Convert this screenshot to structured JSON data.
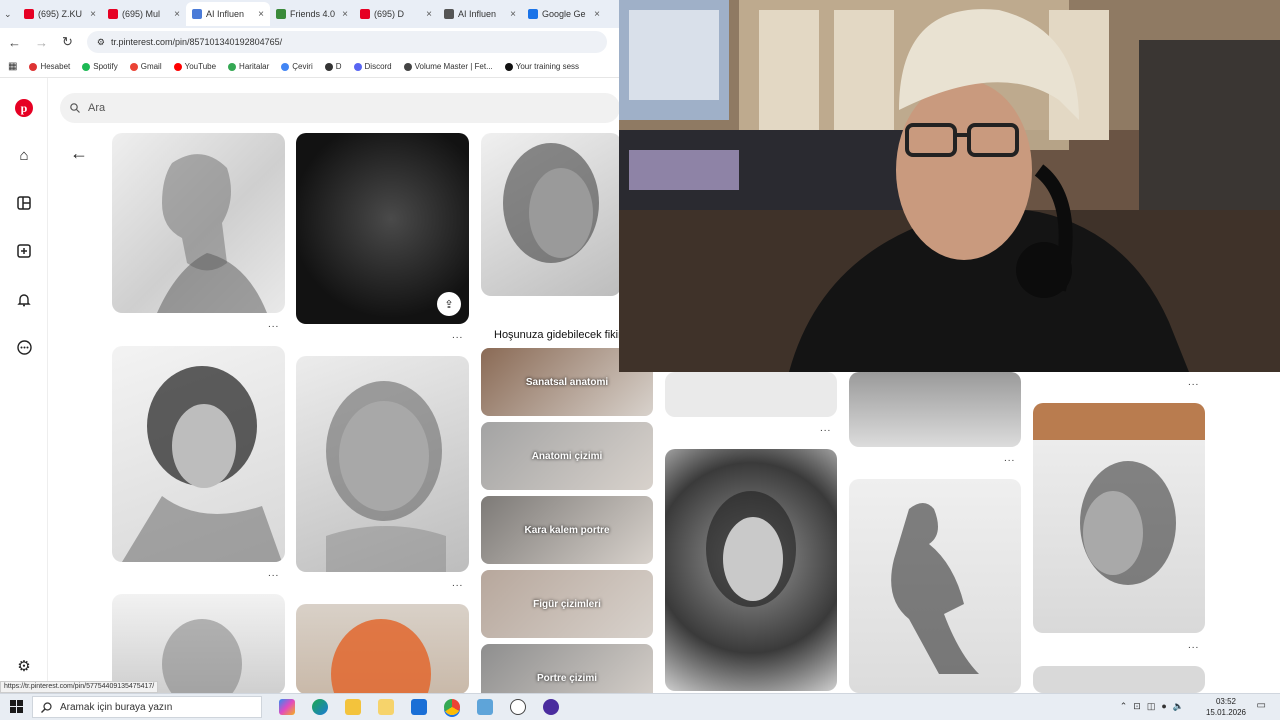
{
  "browser": {
    "tabs": [
      {
        "label": "(695) Z.KU",
        "color": "#e60023"
      },
      {
        "label": "(695) Mul",
        "color": "#e60023"
      },
      {
        "label": "AI Influen",
        "color": "#4a7bd8"
      },
      {
        "label": "Friends 4.0",
        "color": "#3a8a3a"
      },
      {
        "label": "(695) D",
        "color": "#e60023"
      },
      {
        "label": "AI Influen",
        "color": "#555555"
      },
      {
        "label": "Google Ge",
        "color": "#1a73e8"
      }
    ],
    "url": "tr.pinterest.com/pin/857101340192804765/",
    "bookmarks": [
      {
        "label": "Hesabet",
        "color": "#d33"
      },
      {
        "label": "Spotify",
        "color": "#1db954"
      },
      {
        "label": "Gmail",
        "color": "#ea4335"
      },
      {
        "label": "YouTube",
        "color": "#ff0000"
      },
      {
        "label": "Haritalar",
        "color": "#34a853"
      },
      {
        "label": "Çeviri",
        "color": "#4285f4"
      },
      {
        "label": "D",
        "color": "#333333"
      },
      {
        "label": "Discord",
        "color": "#5865f2"
      },
      {
        "label": "Volume Master | Fet...",
        "color": "#444444"
      },
      {
        "label": "Your training sess",
        "color": "#111111"
      }
    ],
    "status_url": "https://tr.pinterest.com/pin/57754409135475417/"
  },
  "pinterest": {
    "search_placeholder": "Ara",
    "suggestions_title": "Hoşunuza gidebilecek fikirler",
    "categories": [
      {
        "label": "Sanatsal anatomi",
        "color": "#8a6a55"
      },
      {
        "label": "Anatomi çizimi",
        "color": "#a3a3a3"
      },
      {
        "label": "Kara kalem portre",
        "color": "#7d7a77"
      },
      {
        "label": "Figür çizimleri",
        "color": "#b7a79c"
      },
      {
        "label": "Portre çizimi",
        "color": "#8e8e8e"
      }
    ],
    "more_label": "..."
  },
  "taskbar": {
    "search_placeholder": "Aramak için buraya yazın",
    "time": "03:52",
    "date": "15.01.2026"
  }
}
